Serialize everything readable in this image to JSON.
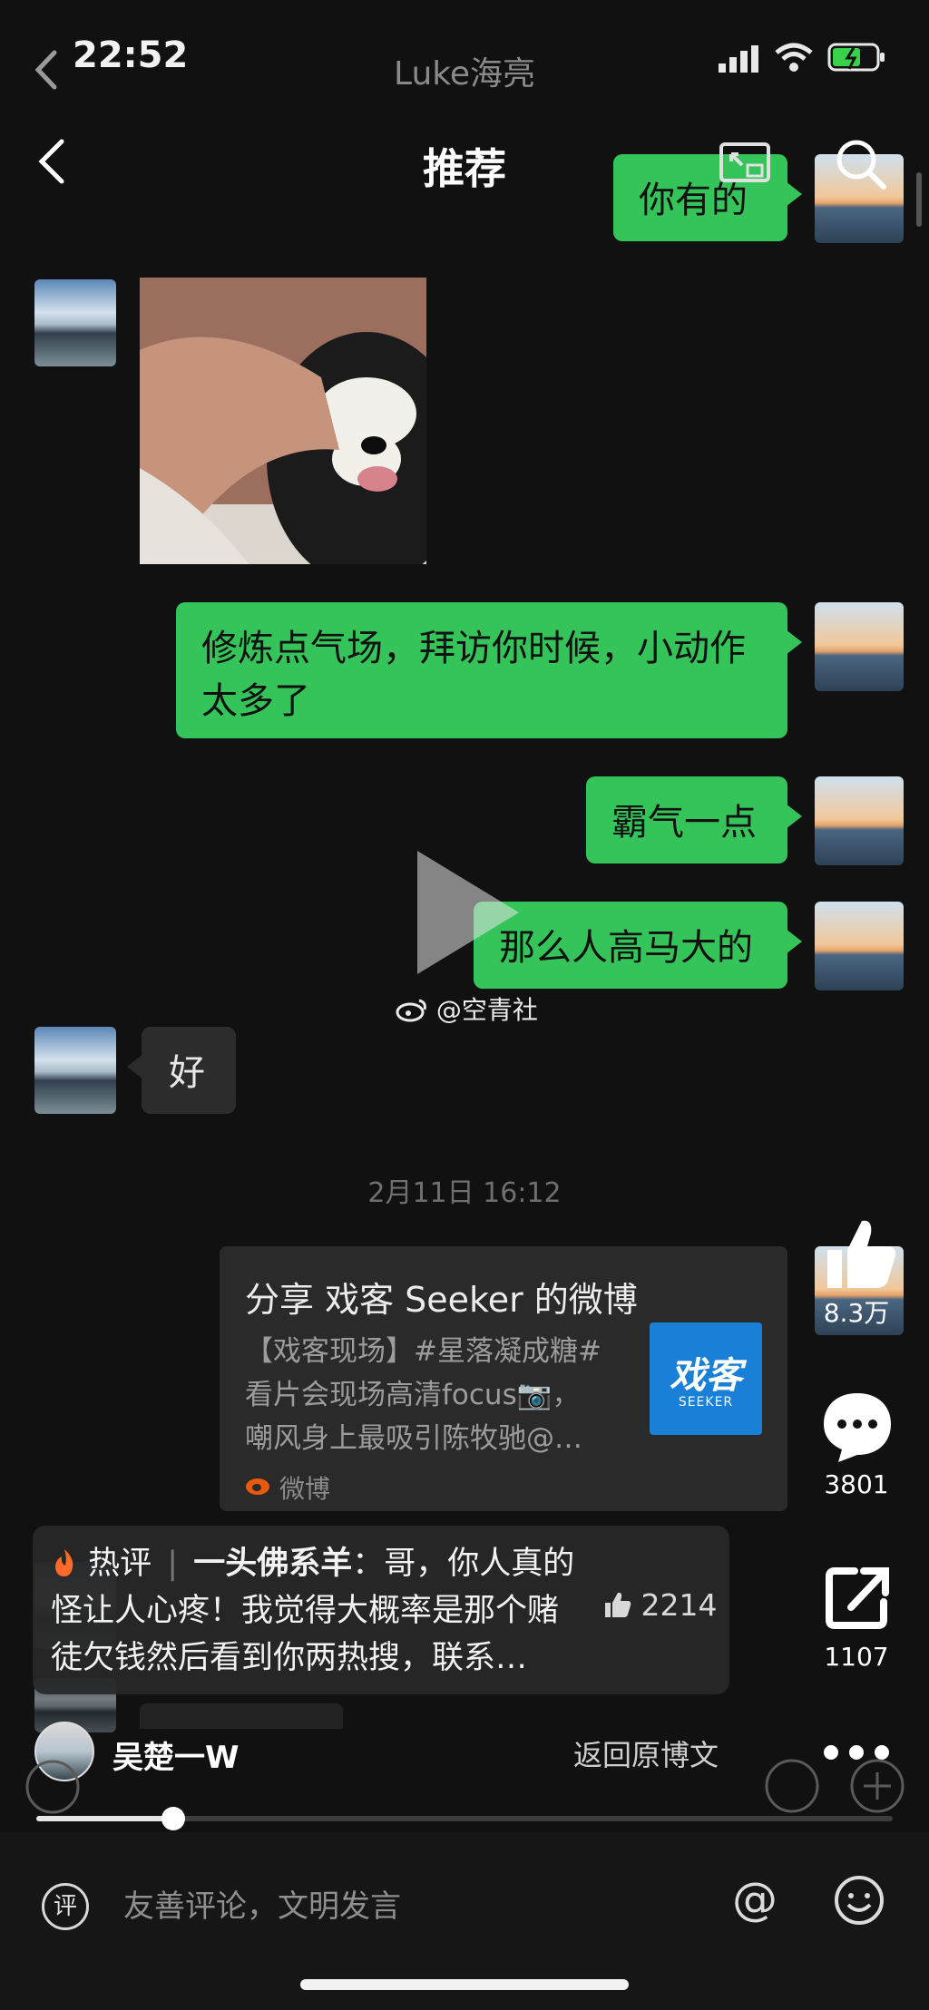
{
  "status_bar": {
    "time": "22:52",
    "window_title": "Luke海亮"
  },
  "nav": {
    "title": "推荐"
  },
  "chat": {
    "messages": [
      {
        "side": "right",
        "type": "text",
        "text": "你有的"
      },
      {
        "side": "left",
        "type": "image"
      },
      {
        "side": "right",
        "type": "text",
        "line1": "修炼点气场，拜访你时候，小动作",
        "line2": "太多了"
      },
      {
        "side": "right",
        "type": "text",
        "text": "霸气一点"
      },
      {
        "side": "right",
        "type": "text",
        "text": "那么人高马大的"
      },
      {
        "side": "left",
        "type": "text",
        "text": "好"
      }
    ],
    "timestamp": "2月11日 16:12",
    "share_card": {
      "title": "分享 戏客 Seeker 的微博",
      "desc_line1": "【戏客现场】#星落凝成糖#",
      "desc_line2": "看片会现场高清focus📷，",
      "desc_line3": "嘲风身上最吸引陈牧驰@…",
      "thumb_label": "戏客",
      "thumb_sub": "SEEKER",
      "source": "微博"
    }
  },
  "video": {
    "watermark": "@空青社",
    "likes": "8.3万",
    "comments": "3801",
    "shares": "1107"
  },
  "hot_comment": {
    "badge": "热评",
    "author": "一头佛系羊",
    "line1_rest": "：哥，你人真的",
    "line2": "怪让人心疼！我觉得大概率是那个赌",
    "line3": "徒欠钱然后看到你两热搜，联系…",
    "like_count": "2214"
  },
  "author": {
    "name": "吴楚一W"
  },
  "return_link": "返回原博文",
  "progress": {
    "fraction": 0.16
  },
  "comment_input": {
    "placeholder": "友善评论，文明发言",
    "icon_char": "评"
  },
  "colors": {
    "green_bubble": "#35c45a",
    "background": "#111111",
    "weibo_orange": "#e8590c"
  }
}
